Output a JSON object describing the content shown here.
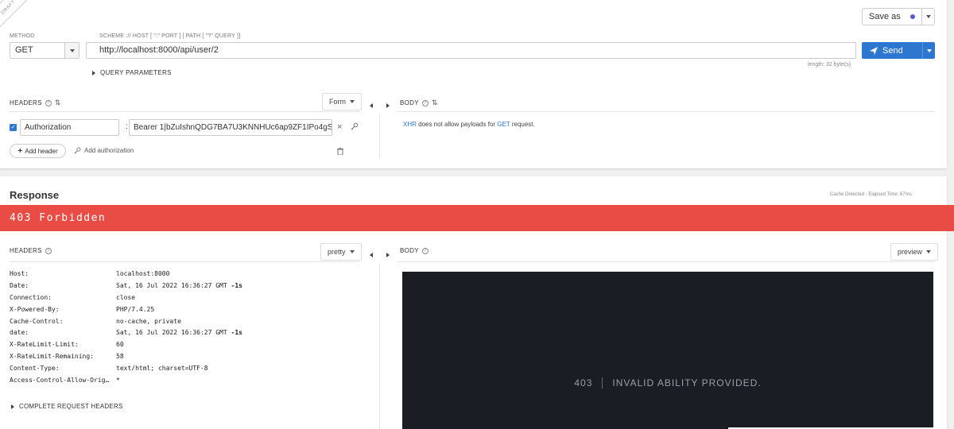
{
  "draft_label": "DRAFT",
  "save_as": {
    "label": "Save as"
  },
  "request": {
    "method_label": "METHOD",
    "method": "GET",
    "url_label": "SCHEME :// HOST [ \":\" PORT ] [ PATH [ \"?\" QUERY ]]",
    "url": "http://localhost:8000/api/user/2",
    "length": "length: 32 byte(s)",
    "send_label": "Send",
    "query_params": "QUERY PARAMETERS",
    "headers_title": "HEADERS",
    "headers_mode": "Form",
    "body_title": "BODY",
    "header_name": "Authorization",
    "header_value": "Bearer 1|bZuIshnQDG7BA7U3KNNHUc6ap9ZF1IPo4gS",
    "add_header": "Add header",
    "add_authorization": "Add authorization",
    "body_note": {
      "xhr": "XHR",
      "mid": " does not allow payloads for ",
      "method": "GET",
      "end": " request."
    }
  },
  "response": {
    "title": "Response",
    "cache_info": "Cache Detected - Elapsed Time: 67ms",
    "status": "403 Forbidden",
    "headers_title": "HEADERS",
    "headers_mode": "pretty",
    "body_title": "BODY",
    "body_mode": "preview",
    "headers": [
      {
        "key": "Host:",
        "value": "localhost:8000",
        "suffix": ""
      },
      {
        "key": "Date:",
        "value": "Sat, 16 Jul 2022 16:36:27 GMT ",
        "suffix": "-1s"
      },
      {
        "key": "Connection:",
        "value": "close",
        "suffix": ""
      },
      {
        "key": "X-Powered-By:",
        "value": "PHP/7.4.25",
        "suffix": ""
      },
      {
        "key": "Cache-Control:",
        "value": "no-cache, private",
        "suffix": ""
      },
      {
        "key": "date:",
        "value": "Sat, 16 Jul 2022 16:36:27 GMT ",
        "suffix": "-1s"
      },
      {
        "key": "X-RateLimit-Limit:",
        "value": "60",
        "suffix": ""
      },
      {
        "key": "X-RateLimit-Remaining:",
        "value": "58",
        "suffix": ""
      },
      {
        "key": "Content-Type:",
        "value": "text/html; charset=UTF-8",
        "suffix": ""
      },
      {
        "key": "Access-Control-Allow-Orig…",
        "value": "*",
        "suffix": ""
      }
    ],
    "complete_headers": "COMPLETE REQUEST HEADERS",
    "preview": {
      "code": "403",
      "message": "INVALID ABILITY PROVIDED."
    }
  }
}
